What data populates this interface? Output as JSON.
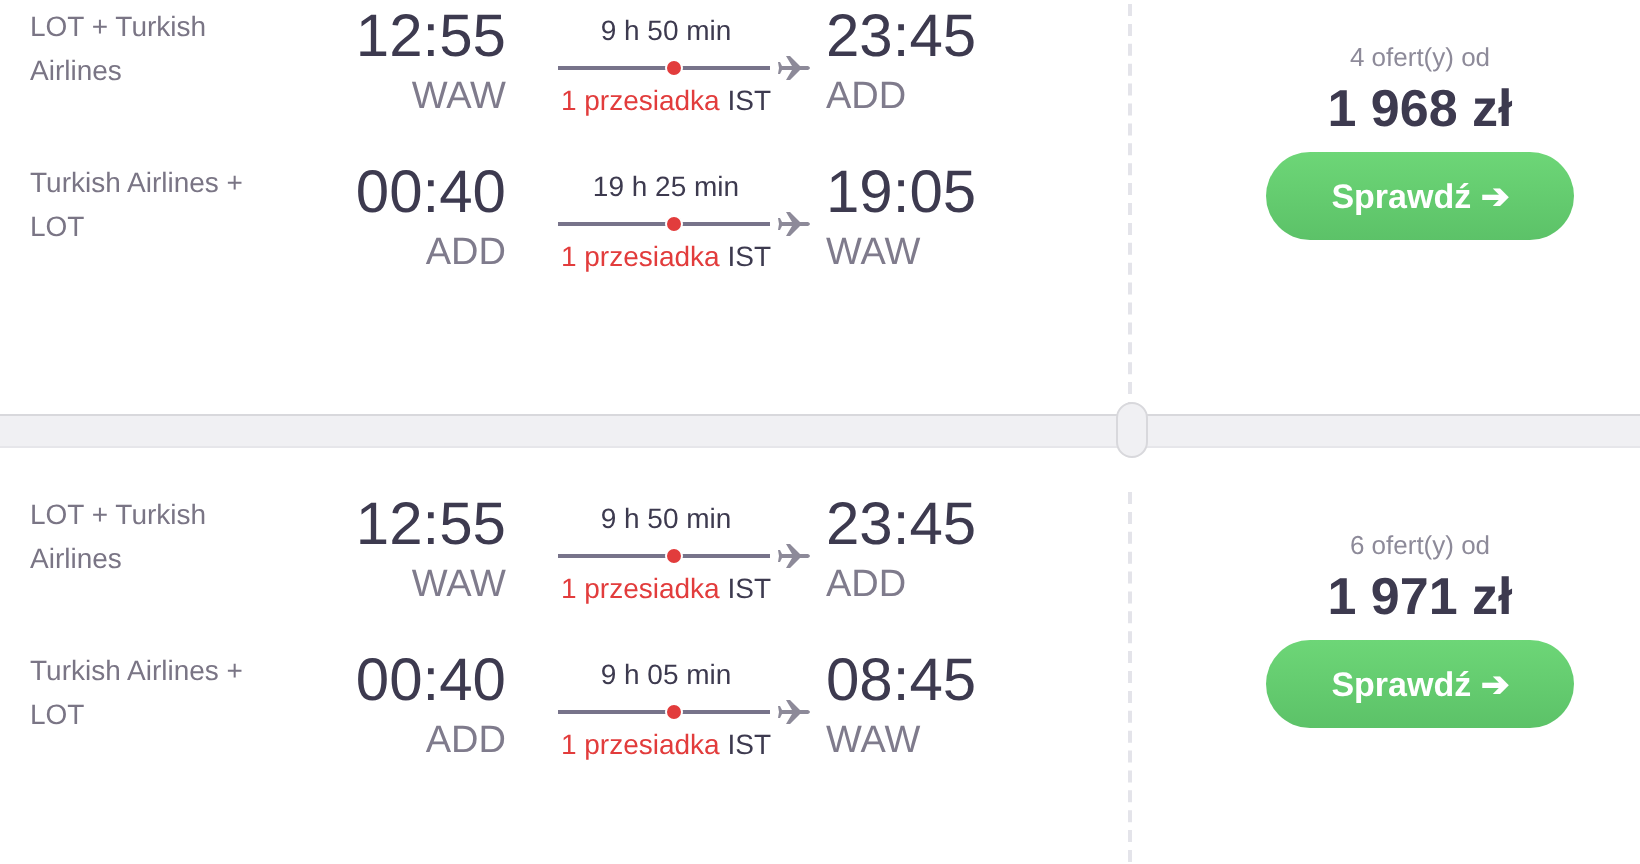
{
  "offers": [
    {
      "legs": [
        {
          "airline": "LOT + Turkish Airlines",
          "depart_time": "12:55",
          "depart_airport": "WAW",
          "duration": "9 h 50 min",
          "stops": "1 przesiadka",
          "via": "IST",
          "arrive_time": "23:45",
          "arrive_airport": "ADD"
        },
        {
          "airline": "Turkish Airlines + LOT",
          "depart_time": "00:40",
          "depart_airport": "ADD",
          "duration": "19 h 25 min",
          "stops": "1 przesiadka",
          "via": "IST",
          "arrive_time": "19:05",
          "arrive_airport": "WAW"
        }
      ],
      "offers_count": "4 ofert(y) od",
      "price": "1 968 zł",
      "button": "Sprawdź ➔"
    },
    {
      "legs": [
        {
          "airline": "LOT + Turkish Airlines",
          "depart_time": "12:55",
          "depart_airport": "WAW",
          "duration": "9 h 50 min",
          "stops": "1 przesiadka",
          "via": "IST",
          "arrive_time": "23:45",
          "arrive_airport": "ADD"
        },
        {
          "airline": "Turkish Airlines + LOT",
          "depart_time": "00:40",
          "depart_airport": "ADD",
          "duration": "9 h 05 min",
          "stops": "1 przesiadka",
          "via": "IST",
          "arrive_time": "08:45",
          "arrive_airport": "WAW"
        }
      ],
      "offers_count": "6 ofert(y) od",
      "price": "1 971 zł",
      "button": "Sprawdź ➔"
    }
  ]
}
